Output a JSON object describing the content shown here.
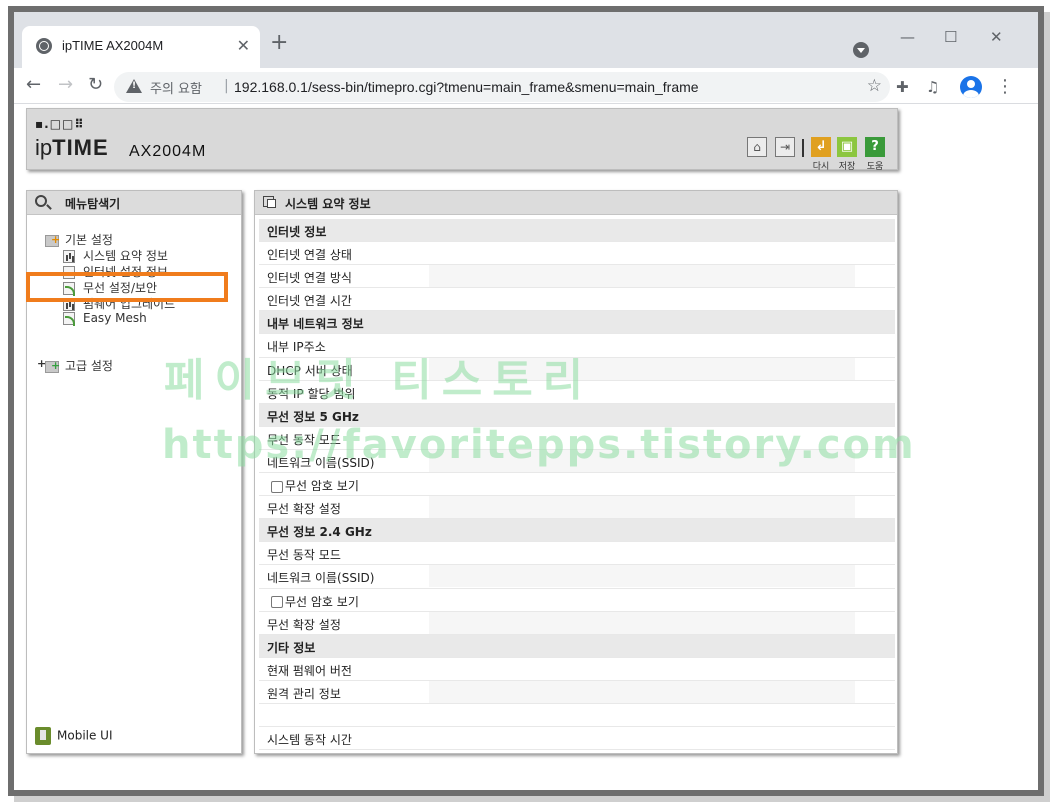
{
  "browser": {
    "tab_title": "ipTIME AX2004M",
    "tab_close": "✕",
    "new_tab": "+",
    "security_label": "주의 요함",
    "separator": "|",
    "url": "192.168.0.1/sess-bin/timepro.cgi?tmenu=main_frame&smenu=main_frame",
    "window_controls": [
      "—",
      "☐",
      "✕"
    ]
  },
  "header": {
    "brand_dots": "▪.□□⠿",
    "brand_prefix": "ip",
    "brand_bold": "TIME",
    "model": "AX2004M",
    "buttons": [
      {
        "label": "다시",
        "color": "#e0a020"
      },
      {
        "label": "저장",
        "color": "#8cc63f"
      },
      {
        "label": "도움",
        "color": "#3a9a3a"
      }
    ]
  },
  "menu": {
    "title": "메뉴탐색기",
    "basic": {
      "label": "기본 설정",
      "items": [
        "시스템 요약 정보",
        "인터넷 설정 정보",
        "무선 설정/보안",
        "펌웨어 업그레이드",
        "Easy Mesh"
      ]
    },
    "advanced": {
      "label": "고급 설정",
      "expander": "+"
    },
    "mobile_label": "Mobile UI"
  },
  "info": {
    "title": "시스템 요약 정보",
    "rows": [
      {
        "text": "인터넷 정보",
        "type": "section"
      },
      {
        "text": "인터넷 연결 상태",
        "type": "row"
      },
      {
        "text": "인터넷 연결 방식",
        "type": "alt"
      },
      {
        "text": "인터넷 연결 시간",
        "type": "row"
      },
      {
        "text": "내부 네트워크 정보",
        "type": "section"
      },
      {
        "text": "내부 IP주소",
        "type": "row"
      },
      {
        "text": "DHCP 서버 상태",
        "type": "alt"
      },
      {
        "text": "동적 IP 할당 범위",
        "type": "row"
      },
      {
        "text": "무선 정보 5 GHz",
        "type": "section"
      },
      {
        "text": "무선 동작 모드",
        "type": "row"
      },
      {
        "text": "네트워크 이름(SSID)",
        "type": "alt"
      },
      {
        "text": "무선 암호 보기",
        "type": "checkbox"
      },
      {
        "text": "무선 확장 설정",
        "type": "alt"
      },
      {
        "text": "무선 정보 2.4 GHz",
        "type": "section"
      },
      {
        "text": "무선 동작 모드",
        "type": "row"
      },
      {
        "text": "네트워크 이름(SSID)",
        "type": "alt"
      },
      {
        "text": "무선 암호 보기",
        "type": "checkbox"
      },
      {
        "text": "무선 확장 설정",
        "type": "alt"
      },
      {
        "text": "기타 정보",
        "type": "section"
      },
      {
        "text": "현재 펌웨어 버전",
        "type": "row"
      },
      {
        "text": "원격 관리 정보",
        "type": "alt"
      },
      {
        "text": "",
        "type": "row"
      },
      {
        "text": "시스템 동작 시간",
        "type": "row"
      }
    ]
  },
  "watermark": {
    "line1": "페이브릿 티스토리",
    "line2": "https://favoritepps.tistory.com"
  }
}
